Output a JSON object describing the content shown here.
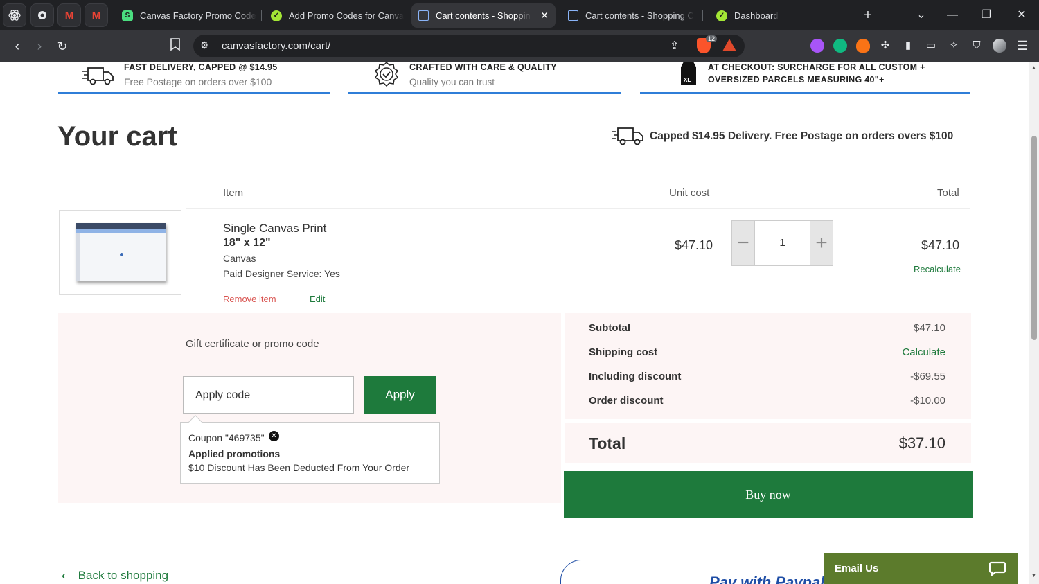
{
  "browser": {
    "tabs": [
      {
        "title": "Canvas Factory Promo Code",
        "active": false
      },
      {
        "title": "Add Promo Codes for Canva",
        "active": false
      },
      {
        "title": "Cart contents - Shopping",
        "active": true
      },
      {
        "title": "Cart contents - Shopping C",
        "active": false
      },
      {
        "title": "Dashboard",
        "active": false
      }
    ],
    "url": "canvasfactory.com/cart/",
    "brave_badge": "12"
  },
  "banners": [
    {
      "title": "FAST DELIVERY, CAPPED @ $14.95",
      "subtitle": "Free Postage on orders over $100"
    },
    {
      "title": "CRAFTED WITH CARE & QUALITY",
      "subtitle": "Quality you can trust"
    },
    {
      "title_line1": "AT CHECKOUT: SURCHARGE FOR ALL CUSTOM +",
      "title_line2": "OVERSIZED PARCELS MEASURING 40\"+"
    }
  ],
  "cart": {
    "heading": "Your cart",
    "delivery_note": "Capped $14.95 Delivery. Free Postage on orders overs $100",
    "columns": {
      "item": "Item",
      "unit_cost": "Unit cost",
      "total": "Total"
    },
    "item": {
      "name": "Single Canvas Print",
      "size": "18\" x 12\"",
      "material": "Canvas",
      "designer_service": "Paid Designer Service:  Yes",
      "unit_cost": "$47.10",
      "quantity": "1",
      "total": "$47.10",
      "recalculate": "Recalculate",
      "remove": "Remove item",
      "edit": "Edit"
    }
  },
  "promo": {
    "label": "Gift certificate or promo code",
    "placeholder": "Apply code",
    "apply_button": "Apply",
    "coupon_text": "Coupon \"469735\"",
    "promotions_title": "Applied promotions",
    "promotion_desc": "$10 Discount Has Been Deducted From Your Order"
  },
  "summary": {
    "rows": [
      {
        "label": "Subtotal",
        "value": "$47.10"
      },
      {
        "label": "Shipping cost",
        "value": "Calculate"
      },
      {
        "label": "Including discount",
        "value": "-$69.55"
      },
      {
        "label": "Order discount",
        "value": "-$10.00"
      }
    ],
    "total_label": "Total",
    "total_value": "$37.10",
    "buy_now": "Buy now"
  },
  "footer": {
    "back_link": "Back to shopping",
    "paypal_text": "Pay with Paypal",
    "email_us": "Email Us"
  },
  "colors": {
    "brand_green": "#1e7a3c",
    "banner_accent": "#2f7ed8",
    "panel_pink": "#fdf5f5",
    "remove_red": "#d9534f"
  }
}
